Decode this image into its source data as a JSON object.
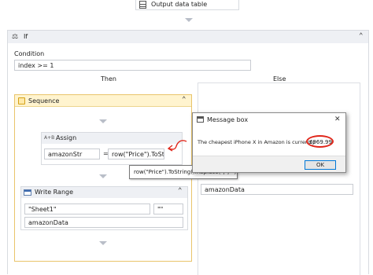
{
  "output_activity": {
    "label": "Output data table"
  },
  "if_activity": {
    "label": "If",
    "condition_label": "Condition",
    "condition_value": "index >= 1",
    "then_label": "Then",
    "else_label": "Else"
  },
  "sequence": {
    "label": "Sequence"
  },
  "assign": {
    "label": "Assign",
    "to_value": "amazonStr",
    "equals": "=",
    "value_expr": "row(\"Price\").ToStrir"
  },
  "tooltip": {
    "text": "row(\"Price\").ToString().Replace(\",\",\"\")"
  },
  "write_range": {
    "label": "Write Range",
    "sheet_value": "\"Sheet1\"",
    "range_value": "\"\"",
    "datatable_value": "amazonData"
  },
  "else_panel": {
    "datatable_value": "amazonData"
  },
  "message_box": {
    "title": "Message box",
    "message": "The cheapest iPhone X in Amazon is currently",
    "price": "£969.99",
    "ok_label": "OK",
    "close_glyph": "✕"
  },
  "colors": {
    "sequence_header": "#fff4cf",
    "sequence_border": "#e9c46a",
    "annotation_red": "#e0261a",
    "ok_border": "#0078d7"
  }
}
